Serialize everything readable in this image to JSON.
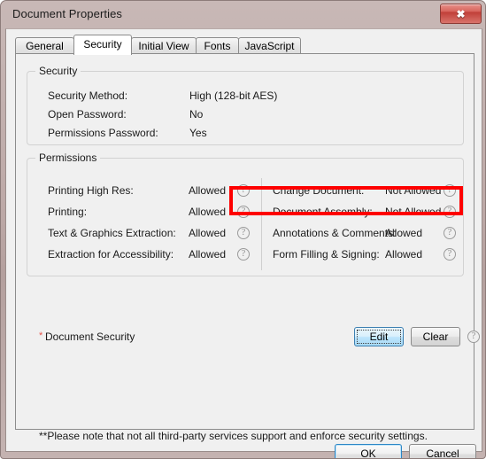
{
  "window": {
    "title": "Document Properties",
    "close_label": "✖"
  },
  "tabs": [
    {
      "label": "General",
      "selected": false
    },
    {
      "label": "Security",
      "selected": true
    },
    {
      "label": "Initial View",
      "selected": false
    },
    {
      "label": "Fonts",
      "selected": false
    },
    {
      "label": "JavaScript",
      "selected": false
    }
  ],
  "security_group": {
    "legend": "Security",
    "rows": [
      {
        "label": "Security Method:",
        "value": "High (128-bit AES)"
      },
      {
        "label": "Open Password:",
        "value": "No"
      },
      {
        "label": "Permissions Password:",
        "value": "Yes"
      }
    ]
  },
  "permissions_group": {
    "legend": "Permissions",
    "left_column": [
      {
        "label": "Printing High Res:",
        "value": "Allowed",
        "starred": false,
        "help": "help-icon"
      },
      {
        "label": "Printing:",
        "value": "Allowed",
        "starred": false,
        "help": "help-icon"
      },
      {
        "label": "Text & Graphics Extraction:",
        "value": "Allowed",
        "starred": false,
        "help": "help-icon"
      },
      {
        "label": "Extraction for Accessibility:",
        "value": "Allowed",
        "starred": false,
        "help": "help-icon"
      }
    ],
    "right_column": [
      {
        "label": "Change Document:",
        "value": "Not Allowed",
        "starred": true,
        "help": "help-icon"
      },
      {
        "label": "Document Assembly:",
        "value": "Not Allowed",
        "starred": true,
        "help": "help-icon"
      },
      {
        "label": "Annotations & Comments:",
        "value": "Allowed",
        "starred": false,
        "help": "help-icon"
      },
      {
        "label": "Form Filling & Signing:",
        "value": "Allowed",
        "starred": false,
        "help": "help-icon"
      }
    ]
  },
  "document_security": {
    "star": "*",
    "label": "Document Security",
    "edit_label": "Edit",
    "clear_label": "Clear",
    "help": "help-icon"
  },
  "footnote": "**Please note that not all third-party services support and enforce security settings.",
  "dialog_buttons": {
    "ok_label": "OK",
    "cancel_label": "Cancel"
  },
  "annotation": {
    "color": "#fe0000",
    "target": "Document Assembly: Not Allowed"
  }
}
